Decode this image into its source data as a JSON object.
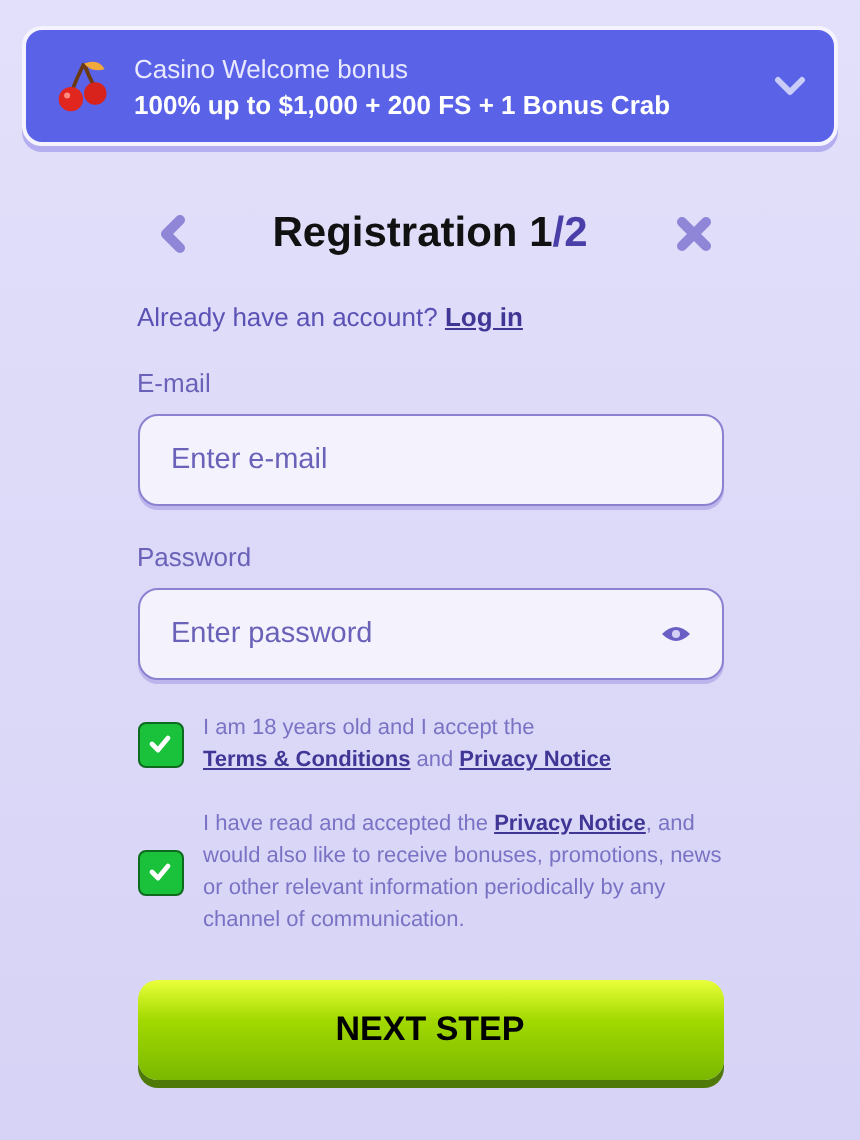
{
  "bonus_banner": {
    "title": "Casino Welcome bonus",
    "offer": "100% up to $1,000 + 200 FS + 1 Bonus Crab",
    "expanded": false
  },
  "header": {
    "title": "Registration 1",
    "step_total": "/2"
  },
  "login_prompt": {
    "text": "Already have an account?",
    "link": "Log in"
  },
  "fields": [
    {
      "label": "E-mail",
      "placeholder": "Enter e-mail",
      "kind": "text"
    },
    {
      "label": "Password",
      "placeholder": "Enter password",
      "kind": "password"
    }
  ],
  "consents": [
    {
      "checked": true,
      "parts": [
        {
          "kind": "text",
          "text": "I am 18 years old and I accept the "
        },
        {
          "kind": "link",
          "text": "Terms & Conditions"
        },
        {
          "kind": "text",
          "text": " and "
        },
        {
          "kind": "link",
          "text": "Privacy Notice"
        }
      ]
    },
    {
      "checked": true,
      "parts": [
        {
          "kind": "text",
          "text": "I have read and accepted the "
        },
        {
          "kind": "link",
          "text": "Privacy Notice"
        },
        {
          "kind": "text",
          "text": ", and would also like to receive bonuses, promotions, news or other relevant information periodically by any channel of communication."
        }
      ]
    }
  ],
  "submit_button": "NEXT STEP"
}
